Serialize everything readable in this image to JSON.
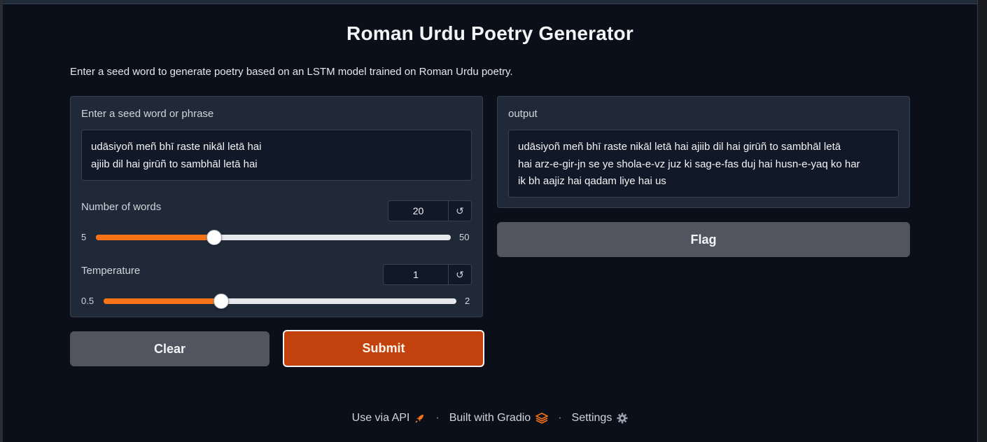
{
  "app": {
    "title": "Roman Urdu Poetry Generator",
    "description": "Enter a seed word to generate poetry based on an LSTM model trained on Roman Urdu poetry."
  },
  "inputs": {
    "seed_label": "Enter a seed word or phrase",
    "seed_lines": [
      "udāsiyoñ meñ bhī raste nikāl letā hai",
      "ajiib dil hai girūñ to sambhāl letā hai"
    ],
    "words": {
      "label": "Number of words",
      "value": "20",
      "min": "5",
      "max": "50",
      "fraction": 0.3333
    },
    "temperature": {
      "label": "Temperature",
      "value": "1",
      "min": "0.5",
      "max": "2",
      "fraction": 0.3333
    }
  },
  "output": {
    "label": "output",
    "lines": [
      "udāsiyoñ meñ bhī raste nikāl letā hai ajiib dil hai girūñ to sambhāl letā",
      "hai arz-e-gir-jn se ye shola-e-vz juz ki sag-e-fas duj hai husn-e-yaq ko har",
      "ik bh aajiz hai qadam liye hai us"
    ]
  },
  "buttons": {
    "clear": "Clear",
    "submit": "Submit",
    "flag": "Flag",
    "reset_glyph": "↺"
  },
  "footer": {
    "api": "Use via API",
    "built": "Built with Gradio",
    "settings": "Settings",
    "separator": "·"
  },
  "colors": {
    "accent": "#f97316",
    "submit": "#c2410c",
    "panel": "#1f2937",
    "background": "#0b0f19"
  },
  "icons": {
    "api": "rocket-icon",
    "gradio": "gradio-logo-icon",
    "settings": "gear-icon",
    "reset": "reset-icon"
  }
}
